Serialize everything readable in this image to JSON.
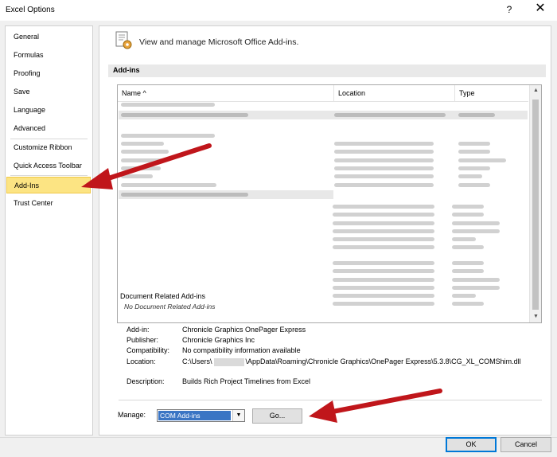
{
  "window": {
    "title": "Excel Options",
    "help_glyph": "?",
    "close_glyph": "✕"
  },
  "nav": {
    "items": [
      {
        "label": "General"
      },
      {
        "label": "Formulas"
      },
      {
        "label": "Proofing"
      },
      {
        "label": "Save"
      },
      {
        "label": "Language"
      },
      {
        "label": "Advanced"
      },
      {
        "label": "Customize Ribbon"
      },
      {
        "label": "Quick Access Toolbar"
      },
      {
        "label": "Add-Ins",
        "selected": true
      },
      {
        "label": "Trust Center"
      }
    ]
  },
  "header": {
    "text": "View and manage Microsoft Office Add-ins."
  },
  "addins": {
    "section_title": "Add-ins",
    "columns": {
      "name": "Name ^",
      "location": "Location",
      "type": "Type"
    },
    "document_group": "Document Related Add-ins",
    "document_note": "No Document Related Add-ins"
  },
  "details": {
    "addin_label": "Add-in:",
    "addin_value": "Chronicle Graphics OnePager Express",
    "publisher_label": "Publisher:",
    "publisher_value": "Chronicle Graphics Inc",
    "compat_label": "Compatibility:",
    "compat_value": "No compatibility information available",
    "location_label": "Location:",
    "location_prefix": "C:\\Users\\",
    "location_suffix": "\\AppData\\Roaming\\Chronicle Graphics\\OnePager Express\\5.3.8\\CG_XL_COMShim.dll",
    "description_label": "Description:",
    "description_value": "Builds Rich Project Timelines from Excel"
  },
  "manage": {
    "label": "Manage:",
    "selected": "COM Add-ins",
    "go_button": "Go..."
  },
  "footer": {
    "ok": "OK",
    "cancel": "Cancel"
  },
  "colors": {
    "selected_nav": "#fce483",
    "annotation_arrow": "#c0161b",
    "select_highlight": "#3a75c4"
  }
}
